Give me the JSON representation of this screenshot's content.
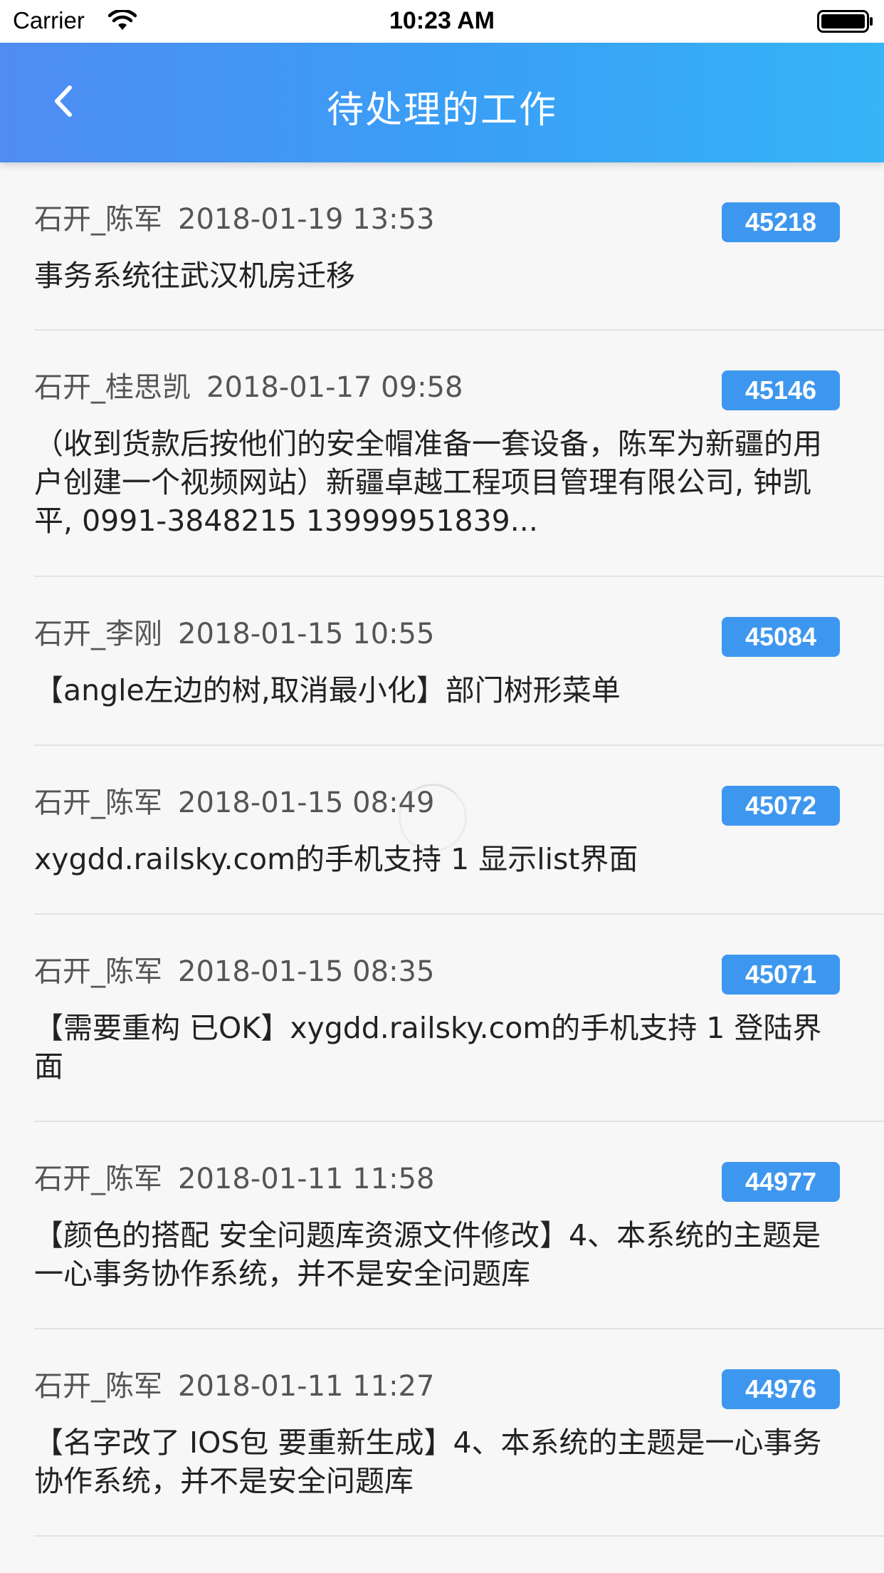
{
  "status_bar": {
    "carrier": "Carrier",
    "time": "10:23 AM"
  },
  "nav": {
    "title": "待处理的工作",
    "back_icon": "chevron-left-icon",
    "gradient": [
      "#4f8cf3",
      "#35b4f7"
    ]
  },
  "tasks": [
    {
      "author": "石开_陈军",
      "datetime": "2018-01-19 13:53",
      "id": "45218",
      "title": "事务系统往武汉机房迁移"
    },
    {
      "author": "石开_桂思凯",
      "datetime": "2018-01-17 09:58",
      "id": "45146",
      "title": "（收到货款后按他们的安全帽准备一套设备，陈军为新疆的用户创建一个视频网站）新疆卓越工程项目管理有限公司, 钟凯平, 0991-3848215 13999951839..."
    },
    {
      "author": "石开_李刚",
      "datetime": "2018-01-15 10:55",
      "id": "45084",
      "title": "【angle左边的树,取消最小化】部门树形菜单"
    },
    {
      "author": "石开_陈军",
      "datetime": "2018-01-15 08:49",
      "id": "45072",
      "title": "xygdd.railsky.com的手机支持 1 显示list界面"
    },
    {
      "author": "石开_陈军",
      "datetime": "2018-01-15 08:35",
      "id": "45071",
      "title": "【需要重构 已OK】xygdd.railsky.com的手机支持 1 登陆界面"
    },
    {
      "author": "石开_陈军",
      "datetime": "2018-01-11 11:58",
      "id": "44977",
      "title": "【颜色的搭配 安全问题库资源文件修改】4、本系统的主题是一心事务协作系统，并不是安全问题库"
    },
    {
      "author": "石开_陈军",
      "datetime": "2018-01-11 11:27",
      "id": "44976",
      "title": "【名字改了 IOS包 要重新生成】4、本系统的主题是一心事务协作系统，并不是安全问题库"
    }
  ],
  "colors": {
    "badge": "#3e97ef",
    "background": "#f7f7f7"
  }
}
